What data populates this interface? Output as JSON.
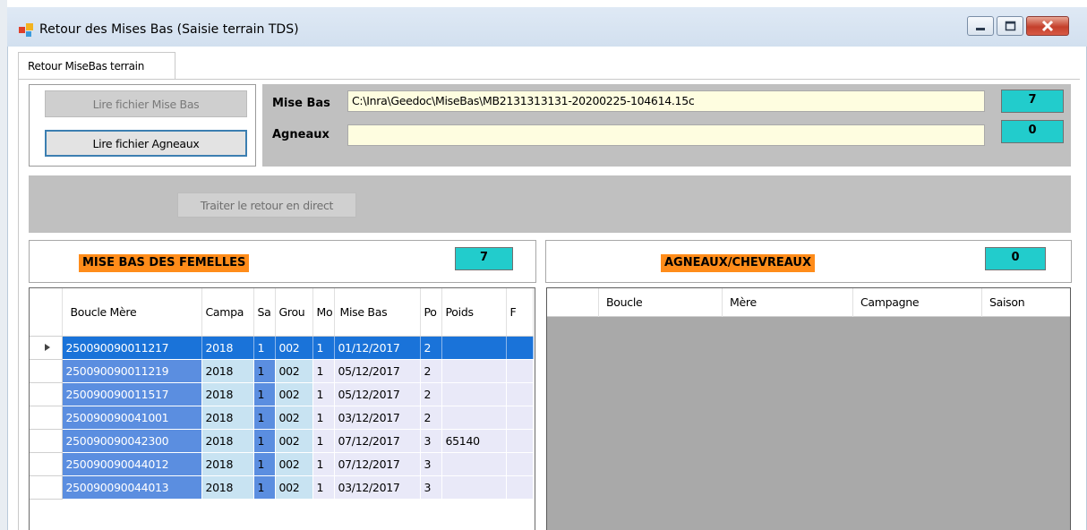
{
  "window": {
    "title": "Retour des Mises Bas (Saisie terrain TDS)"
  },
  "tabs": [
    {
      "label": "Retour MiseBas terrain"
    }
  ],
  "buttons": {
    "lire_misebas": "Lire fichier Mise Bas",
    "lire_agneaux": "Lire fichier Agneaux",
    "traiter": "Traiter le retour en direct"
  },
  "files": {
    "misebas_label": "Mise Bas",
    "misebas_path": "C:\\Inra\\Geedoc\\MiseBas\\MB2131313131-20200225-104614.15c",
    "misebas_count": "7",
    "agneaux_label": "Agneaux",
    "agneaux_path": "",
    "agneaux_count": "0"
  },
  "sections": {
    "femelles_title": "MISE BAS DES FEMELLES",
    "femelles_count": "7",
    "agneaux_title": "AGNEAUX/CHEVREAUX",
    "agneaux_count": "0"
  },
  "grid_femelles": {
    "columns": [
      "Boucle Mère",
      "Campa",
      "Sa",
      "Grou",
      "Mo",
      "Mise Bas",
      "Po",
      "Poids",
      "F"
    ],
    "rows": [
      [
        "250090090011217",
        "2018",
        "1",
        "002",
        "1",
        "01/12/2017",
        "2",
        "",
        ""
      ],
      [
        "250090090011219",
        "2018",
        "1",
        "002",
        "1",
        "05/12/2017",
        "2",
        "",
        ""
      ],
      [
        "250090090011517",
        "2018",
        "1",
        "002",
        "1",
        "05/12/2017",
        "2",
        "",
        ""
      ],
      [
        "250090090041001",
        "2018",
        "1",
        "002",
        "1",
        "03/12/2017",
        "2",
        "",
        ""
      ],
      [
        "250090090042300",
        "2018",
        "1",
        "002",
        "1",
        "07/12/2017",
        "3",
        "65140",
        ""
      ],
      [
        "250090090044012",
        "2018",
        "1",
        "002",
        "1",
        "07/12/2017",
        "3",
        "",
        ""
      ],
      [
        "250090090044013",
        "2018",
        "1",
        "002",
        "1",
        "03/12/2017",
        "3",
        "",
        ""
      ]
    ],
    "selected_row": 0
  },
  "grid_agneaux": {
    "columns": [
      "Boucle",
      "Mère",
      "Campagne",
      "Saison"
    ]
  },
  "colors": {
    "accent_cyan": "#22cccc",
    "section_orange": "#ff8c1a",
    "selection_blue": "#1a73d9",
    "field_yellow": "#fefde0"
  }
}
